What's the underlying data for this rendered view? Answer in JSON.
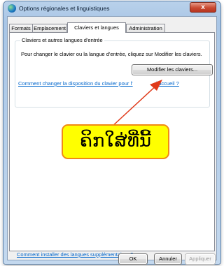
{
  "window": {
    "title": "Options régionales et linguistiques",
    "close_glyph": "x",
    "icon": "globe-icon"
  },
  "tabs": [
    {
      "label": "Formats"
    },
    {
      "label": "Emplacement"
    },
    {
      "label": "Claviers et langues",
      "active": true
    },
    {
      "label": "Administration"
    }
  ],
  "group": {
    "title": "Claviers et autres langues d'entrée",
    "description": "Pour changer le clavier ou la langue d'entrée, cliquez sur Modifier les claviers.",
    "modify_button": "Modifier les claviers...",
    "keyboard_link_start": "Comment changer la disposition du clavier pour l'",
    "keyboard_link_end": "d'accueil ?"
  },
  "install_link": "Comment installer des langues supplémentaires ?",
  "annotation": {
    "text": "ຄິກໃສ່ທີ່ນີ້",
    "box_color": "#ffff00",
    "border_color": "#f08a16",
    "arrow_color": "#e03a1a"
  },
  "buttons": {
    "ok": "OK",
    "cancel": "Annuler",
    "apply": "Appliquer"
  }
}
